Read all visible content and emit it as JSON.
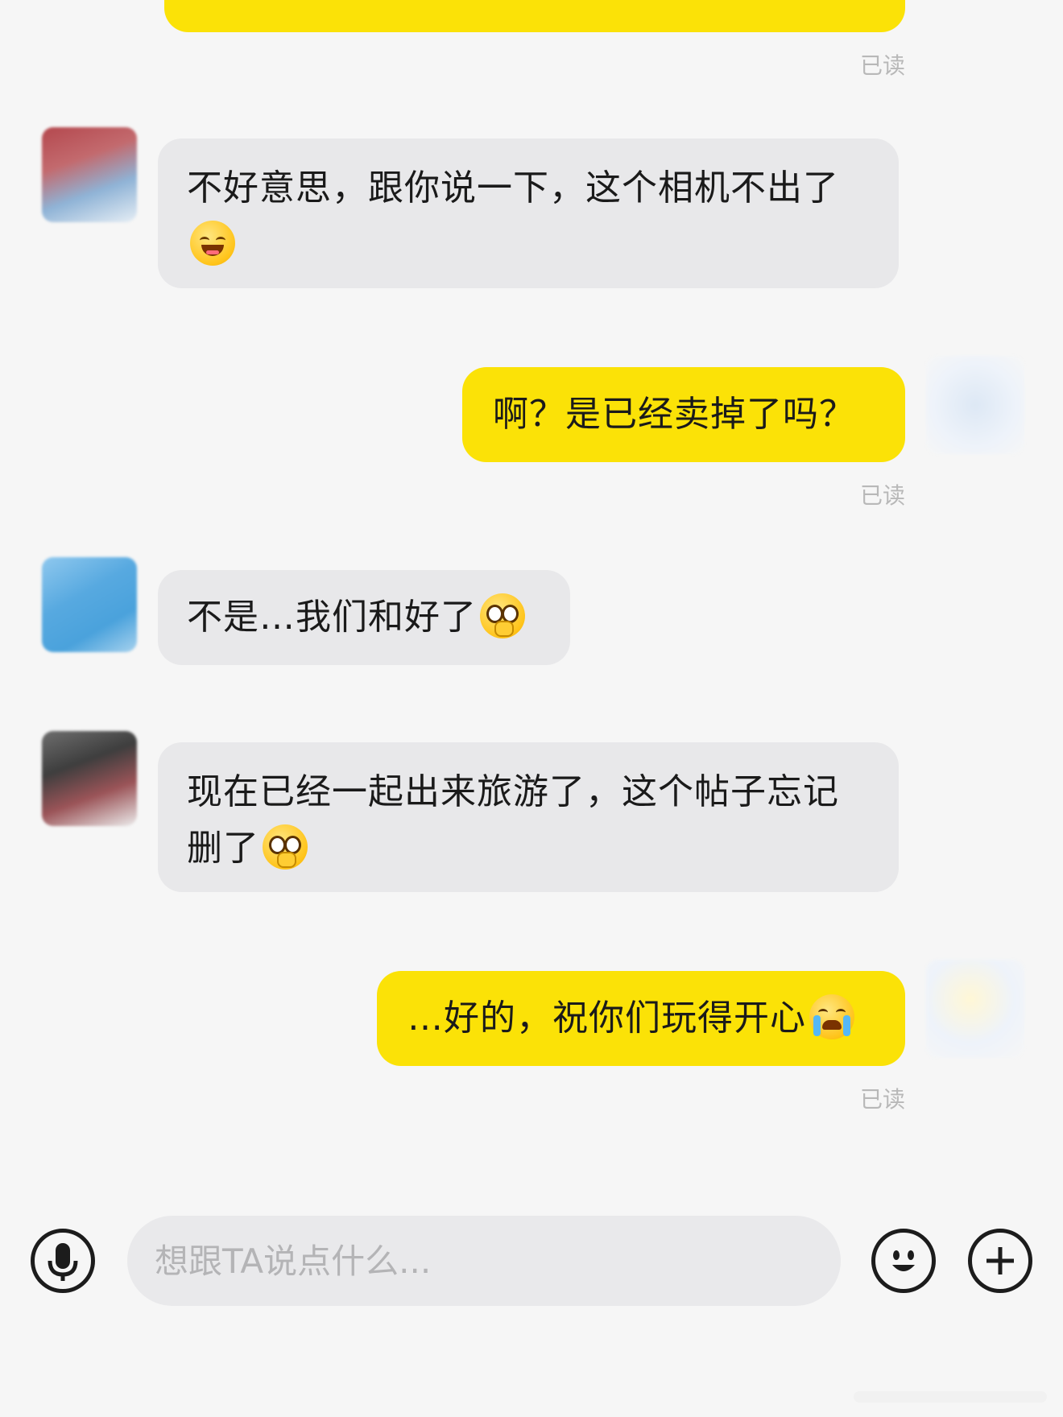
{
  "top_bubble": {
    "partial_text": ""
  },
  "messages": [
    {
      "direction": "in",
      "text": "不好意思，跟你说一下，这个相机不出了",
      "emoji": "grinning-squint-emoji"
    },
    {
      "direction": "out",
      "text": "啊？是已经卖掉了吗？",
      "status": "已读"
    },
    {
      "direction": "in",
      "text": "不是…我们和好了",
      "emoji": "pleading-emoji"
    },
    {
      "direction": "in",
      "text": "现在已经一起出来旅游了，这个帖子忘记删了",
      "emoji": "pleading-emoji"
    },
    {
      "direction": "out",
      "text": "…好的，祝你们玩得开心",
      "emoji": "loudly-crying-emoji",
      "status": "已读"
    }
  ],
  "read_labels": [
    "已读",
    "已读",
    "已读"
  ],
  "input_bar": {
    "placeholder": "想跟TA说点什么...",
    "voice_icon": "microphone-icon",
    "emoji_icon": "emoji-icon",
    "add_icon": "plus-icon"
  },
  "colors": {
    "background": "#f6f6f6",
    "incoming_bubble": "#e8e8ea",
    "outgoing_bubble": "#fbe207",
    "read_label": "#b8b8b8"
  }
}
